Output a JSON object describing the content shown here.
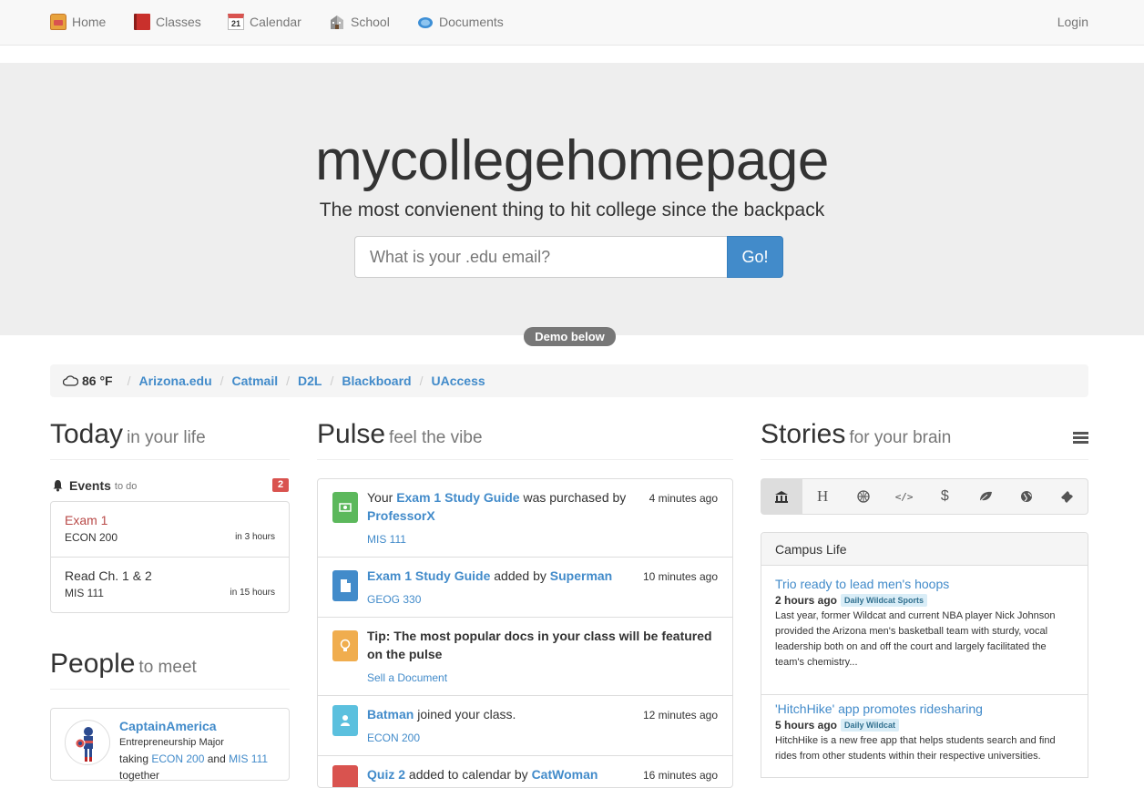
{
  "nav": {
    "items": [
      {
        "label": "Home",
        "icon": "backpack-icon"
      },
      {
        "label": "Classes",
        "icon": "book-icon"
      },
      {
        "label": "Calendar",
        "icon": "calendar-icon",
        "day": "21"
      },
      {
        "label": "School",
        "icon": "building-icon"
      },
      {
        "label": "Documents",
        "icon": "cloud-icon"
      }
    ],
    "login": "Login"
  },
  "hero": {
    "title": "mycollegehomepage",
    "subtitle": "The most convienent thing to hit college since the backpack",
    "email_placeholder": "What is your .edu email?",
    "go": "Go!",
    "demo": "Demo below"
  },
  "crumb": {
    "temp": "86 °F",
    "links": [
      "Arizona.edu",
      "Catmail",
      "D2L",
      "Blackboard",
      "UAccess"
    ]
  },
  "today": {
    "title": "Today",
    "subtitle": "in your life",
    "events_label": "Events",
    "events_sub": "to do",
    "events_count": "2",
    "events": [
      {
        "title": "Exam 1",
        "course": "ECON 200",
        "when": "in 3 hours",
        "color": "#b94a48"
      },
      {
        "title": "Read Ch. 1 & 2",
        "course": "MIS 111",
        "when": "in 15 hours",
        "color": "#333333"
      }
    ]
  },
  "people": {
    "title": "People",
    "subtitle": "to meet",
    "person": {
      "name": "CaptainAmerica",
      "major": "Entrepreneurship Major",
      "taking": "taking",
      "course1": "ECON 200",
      "and": "and",
      "course2": "MIS 111",
      "more": "together"
    }
  },
  "pulse": {
    "title": "Pulse",
    "subtitle": "feel the vibe",
    "items": [
      {
        "icon": "money-icon",
        "color": "#5cb85c",
        "pre": "Your",
        "link": "Exam 1 Study Guide",
        "mid": "was purchased by",
        "user": "ProfessorX",
        "time": "4 minutes ago",
        "tag": "MIS 111"
      },
      {
        "icon": "document-icon",
        "color": "#428bca",
        "link": "Exam 1 Study Guide",
        "mid": "added by",
        "user": "Superman",
        "time": "10 minutes ago",
        "tag": "GEOG 330"
      },
      {
        "icon": "lightbulb-icon",
        "color": "#f0ad4e",
        "tip": "Tip: The most popular docs in your class will be featured on the pulse",
        "tag": "Sell a Document"
      },
      {
        "icon": "user-icon",
        "color": "#5bc0de",
        "user": "Batman",
        "mid": "joined your class.",
        "time": "12 minutes ago",
        "tag": "ECON 200"
      },
      {
        "icon": "calendar-icon",
        "color": "#d9534f",
        "link": "Quiz 2",
        "mid": "added to calendar by",
        "user": "CatWoman",
        "time": "16 minutes ago"
      }
    ]
  },
  "stories": {
    "title": "Stories",
    "subtitle": "for your brain",
    "categories": [
      "bank-icon",
      "heading-icon",
      "basketball-icon",
      "code-icon",
      "dollar-icon",
      "leaf-icon",
      "globe-icon",
      "ticket-icon"
    ],
    "panel_title": "Campus Life",
    "items": [
      {
        "title": "Trio ready to lead men's hoops",
        "time": "2 hours ago",
        "source": "Daily Wildcat Sports",
        "desc": "Last year, former Wildcat and current NBA player Nick Johnson provided the Arizona men's basketball team with sturdy, vocal leadership both on and off the court and largely facilitated the team's chemistry..."
      },
      {
        "title": "'HitchHike' app promotes ridesharing",
        "time": "5 hours ago",
        "source": "Daily Wildcat",
        "desc": "HitchHike is a new free app that helps students search and find rides from other students within their respective universities."
      }
    ]
  }
}
